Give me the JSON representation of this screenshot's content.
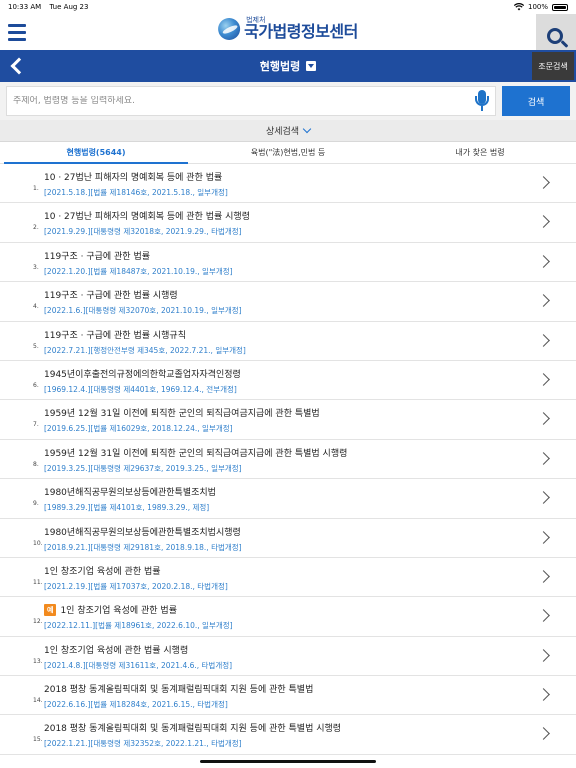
{
  "status": {
    "time": "10:33 AM",
    "date": "Tue Aug 23",
    "battery": "100%",
    "battery_level": 1.0
  },
  "header": {
    "logo_sub": "법제처",
    "logo_main": "국가법령정보센터"
  },
  "title_bar": {
    "title": "현행법령",
    "fulltext_label": "조문검색"
  },
  "search": {
    "placeholder": "주제어, 법령명 등을 입력하세요.",
    "submit_label": "검색"
  },
  "detail_search": {
    "label": "상세검색"
  },
  "tabs": [
    {
      "label": "현행법령(5644)",
      "active": true
    },
    {
      "label": "육법(\"法)현법,민법 등",
      "active": false
    },
    {
      "label": "내가 찾은 법령",
      "active": false
    }
  ],
  "laws": [
    {
      "num": "1.",
      "title": "10 · 27법난 피해자의 명예회복 등에 관한 법률",
      "meta": "[2021.5.18.][법률 제18146호, 2021.5.18., 일부개정]",
      "badge": ""
    },
    {
      "num": "2.",
      "title": "10 · 27법난 피해자의 명예회복 등에 관한 법률 시행령",
      "meta": "[2021.9.29.][대통령령 제32018호, 2021.9.29., 타법개정]",
      "badge": ""
    },
    {
      "num": "3.",
      "title": "119구조 · 구급에 관한 법률",
      "meta": "[2022.1.20.][법률 제18487호, 2021.10.19., 일부개정]",
      "badge": ""
    },
    {
      "num": "4.",
      "title": "119구조 · 구급에 관한 법률 시행령",
      "meta": "[2022.1.6.][대통령령 제32070호, 2021.10.19., 일부개정]",
      "badge": ""
    },
    {
      "num": "5.",
      "title": "119구조 · 구급에 관한 법률 시행규칙",
      "meta": "[2022.7.21.][행정안전부령 제345호, 2022.7.21., 일부개정]",
      "badge": ""
    },
    {
      "num": "6.",
      "title": "1945년이후출전의규정에의한학교졸업자자격인정령",
      "meta": "[1969.12.4.][대통령령 제4401호, 1969.12.4., 전부개정]",
      "badge": ""
    },
    {
      "num": "7.",
      "title": "1959년 12월 31일 이전에 퇴직한 군인의 퇴직급여금지급에 관한 특별법",
      "meta": "[2019.6.25.][법률 제16029호, 2018.12.24., 일부개정]",
      "badge": ""
    },
    {
      "num": "8.",
      "title": "1959년 12월 31일 이전에 퇴직한 군인의 퇴직급여금지급에 관한 특별법 시행령",
      "meta": "[2019.3.25.][대통령령 제29637호, 2019.3.25., 일부개정]",
      "badge": ""
    },
    {
      "num": "9.",
      "title": "1980년해직공무원의보상등에관한특별조치법",
      "meta": "[1989.3.29.][법률 제4101호, 1989.3.29., 제정]",
      "badge": ""
    },
    {
      "num": "10.",
      "title": "1980년해직공무원의보상등에관한특별조치법시행령",
      "meta": "[2018.9.21.][대통령령 제29181호, 2018.9.18., 타법개정]",
      "badge": ""
    },
    {
      "num": "11.",
      "title": "1인 창조기업 육성에 관한 법률",
      "meta": "[2021.2.19.][법률 제17037호, 2020.2.18., 타법개정]",
      "badge": ""
    },
    {
      "num": "12.",
      "title": "1인 창조기업 육성에 관한 법률",
      "meta": "[2022.12.11.][법률 제18961호, 2022.6.10., 일부개정]",
      "badge": "예"
    },
    {
      "num": "13.",
      "title": "1인 창조기업 육성에 관한 법률 시행령",
      "meta": "[2021.4.8.][대통령령 제31611호, 2021.4.6., 타법개정]",
      "badge": ""
    },
    {
      "num": "14.",
      "title": "2018 평창 동계올림픽대회 및 동계패럴림픽대회 지원 등에 관한 특별법",
      "meta": "[2022.6.16.][법률 제18284호, 2021.6.15., 타법개정]",
      "badge": ""
    },
    {
      "num": "15.",
      "title": "2018 평창 동계올림픽대회 및 동계패럴림픽대회 지원 등에 관한 특별법 시행령",
      "meta": "[2022.1.21.][대통령령 제32352호, 2022.1.21., 타법개정]",
      "badge": ""
    }
  ]
}
